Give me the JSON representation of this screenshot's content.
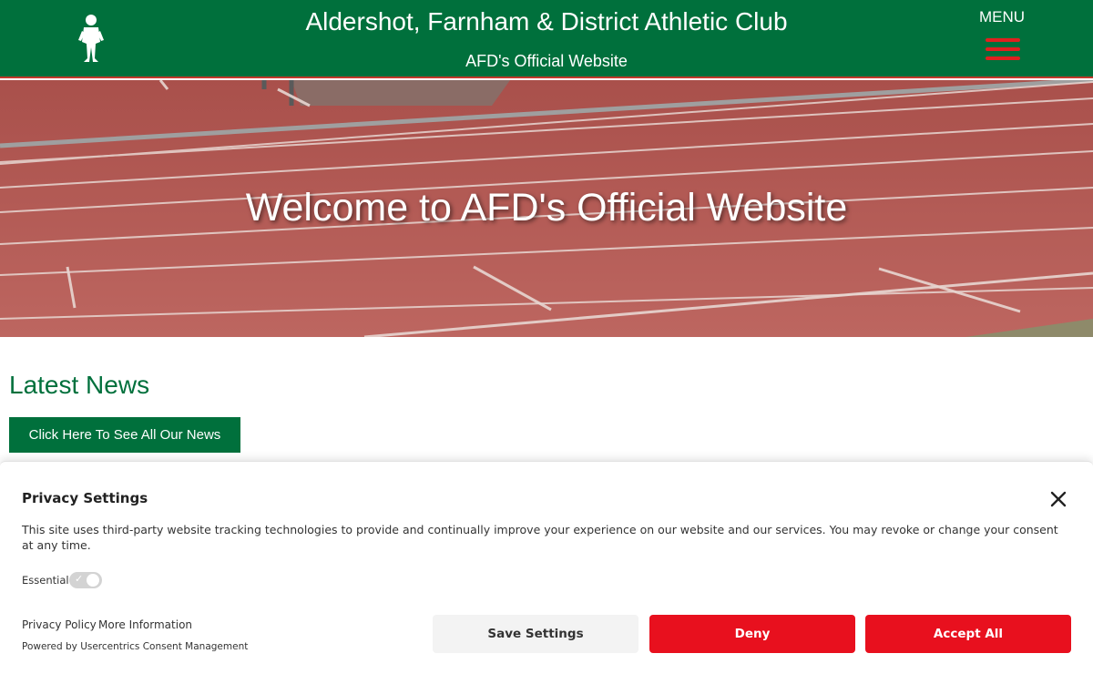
{
  "header": {
    "title": "Aldershot, Farnham & District Athletic Club",
    "subtitle": "AFD's Official Website",
    "menu_label": "MENU",
    "colors": {
      "brand_green": "#00703c",
      "accent_red": "#e0201f"
    }
  },
  "hero": {
    "title": "Welcome to AFD's Official Website"
  },
  "news": {
    "heading": "Latest News",
    "button_label": "Click Here To See All Our News"
  },
  "privacy": {
    "title": "Privacy Settings",
    "text": "This site uses third-party website tracking technologies to provide and continually improve your experience on our website and our services. You may revoke or change your consent at any time.",
    "essential_label": "Essential",
    "essential_enabled": true,
    "privacy_policy_link": "Privacy Policy",
    "more_info_link": "More Information",
    "powered_by": "Powered by Usercentrics Consent Management",
    "save_label": "Save Settings",
    "deny_label": "Deny",
    "accept_label": "Accept All",
    "colors": {
      "button_red": "#e8101e",
      "button_grey": "#f3f3f3"
    }
  }
}
